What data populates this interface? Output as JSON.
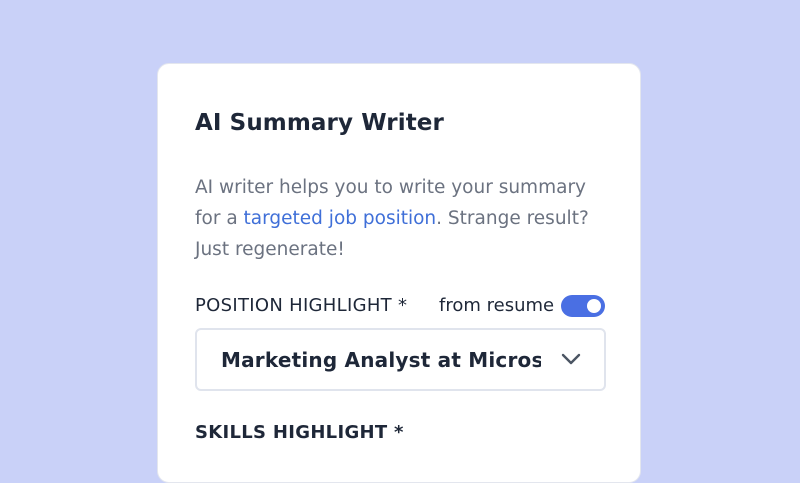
{
  "card": {
    "title": "AI Summary Writer",
    "description": {
      "before_link": "AI writer helps you to write your summary for a ",
      "link": "targeted job position",
      "after_link": ". Strange result? Just regenerate!"
    },
    "position_field": {
      "label": "POSITION HIGHLIGHT *",
      "toggle_label": "from resume",
      "toggle_on": true,
      "selected_value": "Marketing Analyst at Micros…",
      "chevron_icon": "chevron-down-icon"
    },
    "skills_field": {
      "label": "SKILLS HIGHLIGHT *"
    }
  },
  "colors": {
    "background": "#c9d1f8",
    "accent": "#4a6fe3",
    "link": "#3f6fd8",
    "text": "#1e2738",
    "muted_text": "#6b7280"
  }
}
